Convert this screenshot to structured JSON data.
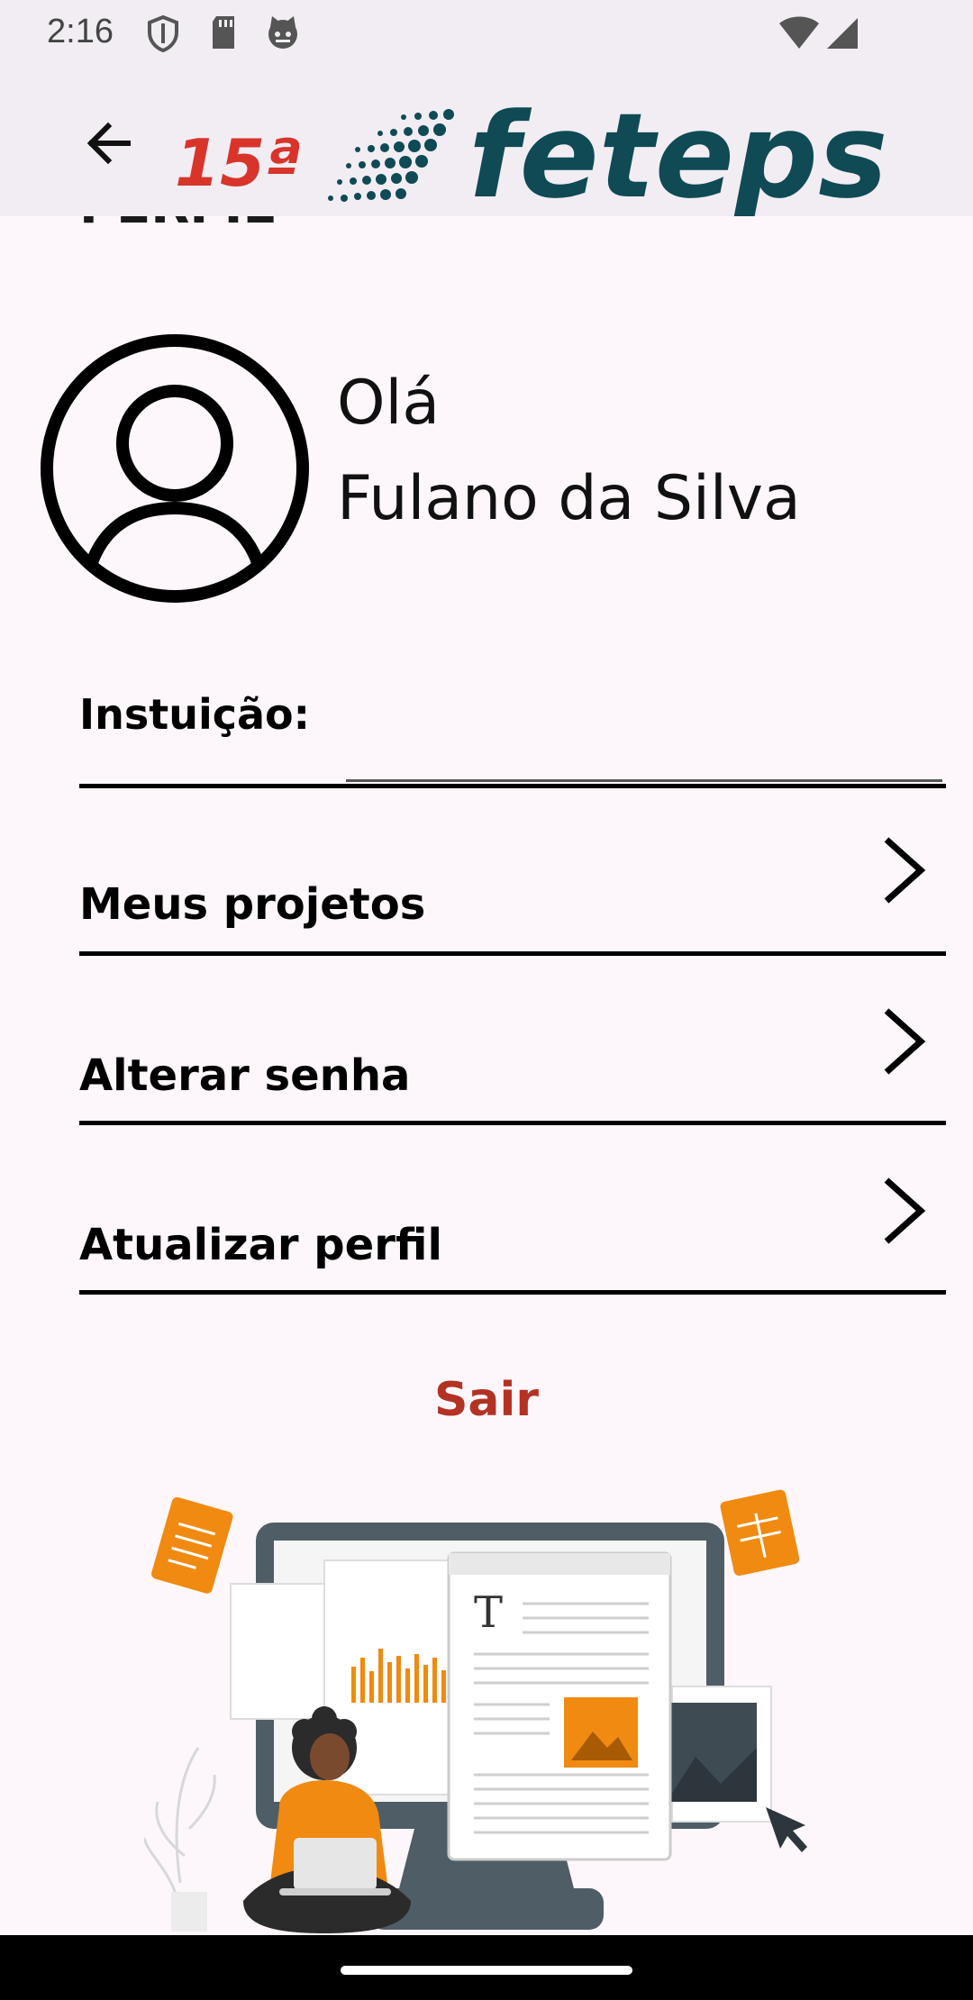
{
  "status_bar": {
    "time": "2:16",
    "icons": [
      "shield-icon",
      "sd-card-icon",
      "cat-face-icon",
      "wifi-icon",
      "cell-signal-icon"
    ]
  },
  "app_bar": {
    "back_icon": "arrow-back-icon",
    "logo_edition": "15ª",
    "logo_text": "feteps"
  },
  "profile": {
    "cut_title": "PERFIL",
    "greeting": "Olá",
    "name": "Fulano da Silva",
    "avatar_icon": "account-circle-icon"
  },
  "institution": {
    "label": "Instuição:",
    "value": ""
  },
  "menu": {
    "items": [
      {
        "label": "Meus projetos",
        "icon": "chevron-right-icon"
      },
      {
        "label": "Alterar senha",
        "icon": "chevron-right-icon"
      },
      {
        "label": "Atualizar perfil",
        "icon": "chevron-right-icon"
      }
    ]
  },
  "logout": {
    "label": "Sair"
  },
  "colors": {
    "background": "#fdf7fb",
    "app_bar": "#f1edf3",
    "logout": "#b33224",
    "logo_red": "#d8342a",
    "logo_teal": "#0f4a55",
    "accent_orange": "#f08a10"
  }
}
